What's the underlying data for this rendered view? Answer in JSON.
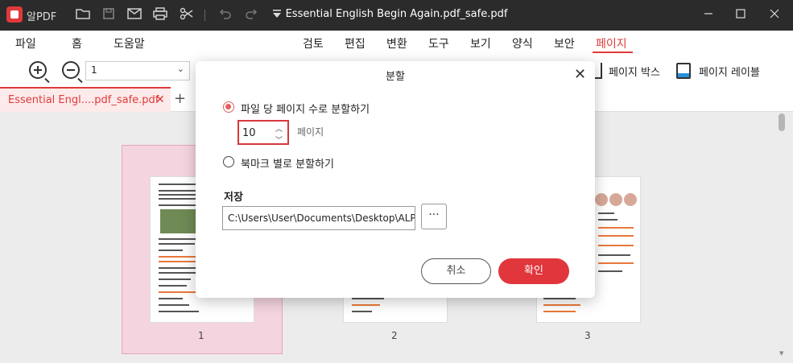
{
  "titlebar": {
    "app_name": "알PDF",
    "document_title": "Essential English Begin Again.pdf_safe.pdf",
    "icons": [
      "folder-icon",
      "save-icon",
      "mail-icon",
      "print-icon",
      "scissors-icon",
      "undo-icon",
      "redo-icon",
      "dropdown-icon"
    ],
    "window_buttons": [
      "minimize",
      "maximize",
      "close"
    ]
  },
  "menubar": {
    "left": [
      {
        "label": "파일"
      },
      {
        "label": "홈"
      },
      {
        "label": "도움말"
      }
    ],
    "tabs": [
      {
        "label": "검토"
      },
      {
        "label": "편집"
      },
      {
        "label": "변환"
      },
      {
        "label": "도구"
      },
      {
        "label": "보기"
      },
      {
        "label": "양식"
      },
      {
        "label": "보안"
      },
      {
        "label": "페이지"
      }
    ],
    "active_tab": "페이지"
  },
  "toolbar": {
    "page_value": "1",
    "page_box_label": "페이지 박스",
    "page_label_label": "페이지 레이블"
  },
  "tab": {
    "label": "Essential Engl....pdf_safe.pdf"
  },
  "pages": [
    {
      "number": "1"
    },
    {
      "number": "2"
    },
    {
      "number": "3"
    }
  ],
  "selected_page": "1",
  "dialog": {
    "title": "분할",
    "option_pages_label": "파일 당 페이지 수로 분할하기",
    "option_pages_checked": true,
    "pages_value": "10",
    "pages_unit": "페이지",
    "option_bookmark_label": "북마크 별로 분할하기",
    "option_bookmark_checked": false,
    "save_label": "저장",
    "save_path": "C:\\Users\\User\\Documents\\Desktop\\ALPDF\\",
    "browse_label": "···",
    "cancel_label": "취소",
    "ok_label": "확인"
  },
  "colors": {
    "accent": "#e0363c",
    "titlebar": "#2b2b2b",
    "selected_page_bg": "#f4d4df"
  }
}
